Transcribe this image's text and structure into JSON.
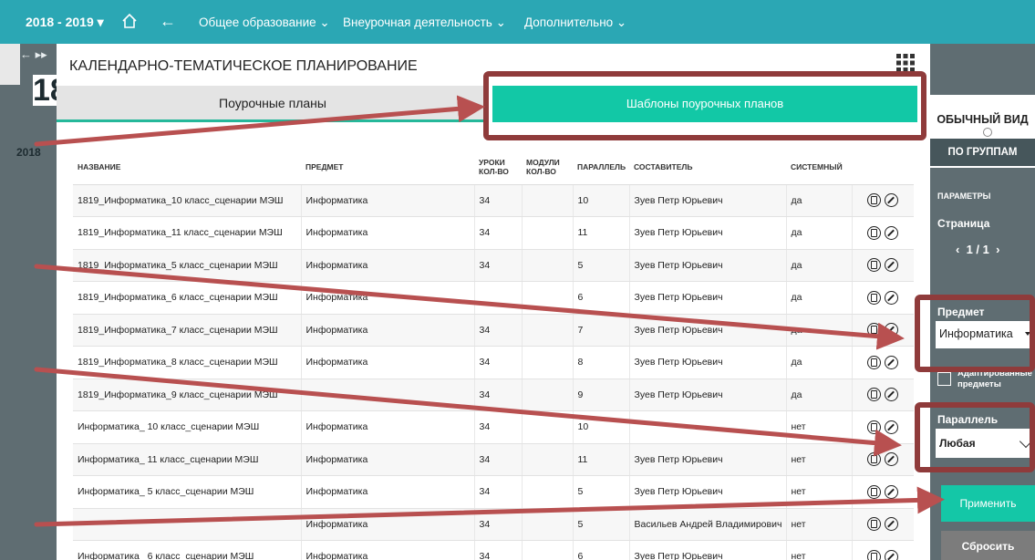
{
  "topbar": {
    "year": "2018 - 2019",
    "nav": [
      "Общее образование",
      "Внеурочная деятельность",
      "Дополнительно"
    ]
  },
  "leftbar": {
    "day": "18",
    "year": "2018"
  },
  "page": {
    "title": "КАЛЕНДАРНО-ТЕМАТИЧЕСКОЕ ПЛАНИРОВАНИЕ",
    "tabs": [
      "Поурочные планы",
      "Шаблоны поурочных планов"
    ],
    "active_tab": 1
  },
  "table": {
    "headers": [
      "НАЗВАНИЕ",
      "ПРЕДМЕТ",
      "УРОКИ КОЛ-ВО",
      "МОДУЛИ КОЛ-ВО",
      "ПАРАЛЛЕЛЬ",
      "СОСТАВИТЕЛЬ",
      "СИСТЕМНЫЙ",
      ""
    ],
    "rows": [
      [
        "1819_Информатика_10 класс_сценарии МЭШ",
        "Информатика",
        "34",
        "",
        "10",
        "Зуев Петр Юрьевич",
        "да"
      ],
      [
        "1819_Информатика_11 класс_сценарии МЭШ",
        "Информатика",
        "34",
        "",
        "11",
        "Зуев Петр Юрьевич",
        "да"
      ],
      [
        "1819_Информатика_5 класс_сценарии МЭШ",
        "Информатика",
        "34",
        "",
        "5",
        "Зуев Петр Юрьевич",
        "да"
      ],
      [
        "1819_Информатика_6 класс_сценарии МЭШ",
        "Информатика",
        "",
        "",
        "6",
        "Зуев Петр Юрьевич",
        "да"
      ],
      [
        "1819_Информатика_7 класс_сценарии МЭШ",
        "Информатика",
        "34",
        "",
        "7",
        "Зуев Петр Юрьевич",
        "да"
      ],
      [
        "1819_Информатика_8 класс_сценарии МЭШ",
        "Информатика",
        "34",
        "",
        "8",
        "Зуев Петр Юрьевич",
        "да"
      ],
      [
        "1819_Информатика_9 класс_сценарии МЭШ",
        "",
        "34",
        "",
        "9",
        "Зуев Петр Юрьевич",
        "да"
      ],
      [
        "Информатика_ 10 класс_сценарии МЭШ",
        "Информатика",
        "34",
        "",
        "10",
        "",
        "нет"
      ],
      [
        "Информатика_ 11 класс_сценарии МЭШ",
        "Информатика",
        "34",
        "",
        "11",
        "Зуев Петр Юрьевич",
        "нет"
      ],
      [
        "Информатика_ 5 класс_сценарии МЭШ",
        "Информатика",
        "34",
        "",
        "5",
        "Зуев Петр Юрьевич",
        "нет"
      ],
      [
        "",
        "Информатика",
        "34",
        "",
        "5",
        "Васильев Андрей Владимирович",
        "нет"
      ],
      [
        "Информатика_ 6 класс_сценарии МЭШ",
        "Информатика",
        "34",
        "",
        "6",
        "Зуев Петр Юрьевич",
        "нет"
      ]
    ]
  },
  "sidebar": {
    "view_normal": "ОБЫЧНЫЙ ВИД",
    "view_groups": "ПО ГРУППАМ",
    "params": "ПАРАМЕТРЫ",
    "page_label": "Страница",
    "pager": "1 / 1",
    "subject_label": "Предмет",
    "subject_value": "Информатика",
    "adapted_label": "Адаптированные предметы",
    "parallel_label": "Параллель",
    "parallel_value": "Любая",
    "apply": "Применить",
    "reset": "Сбросить"
  },
  "colors": {
    "topbar": "#2ba7b4",
    "sidebar": "#5f6d72",
    "accent": "#12c8a6",
    "annotation": "#8f3b3b"
  }
}
